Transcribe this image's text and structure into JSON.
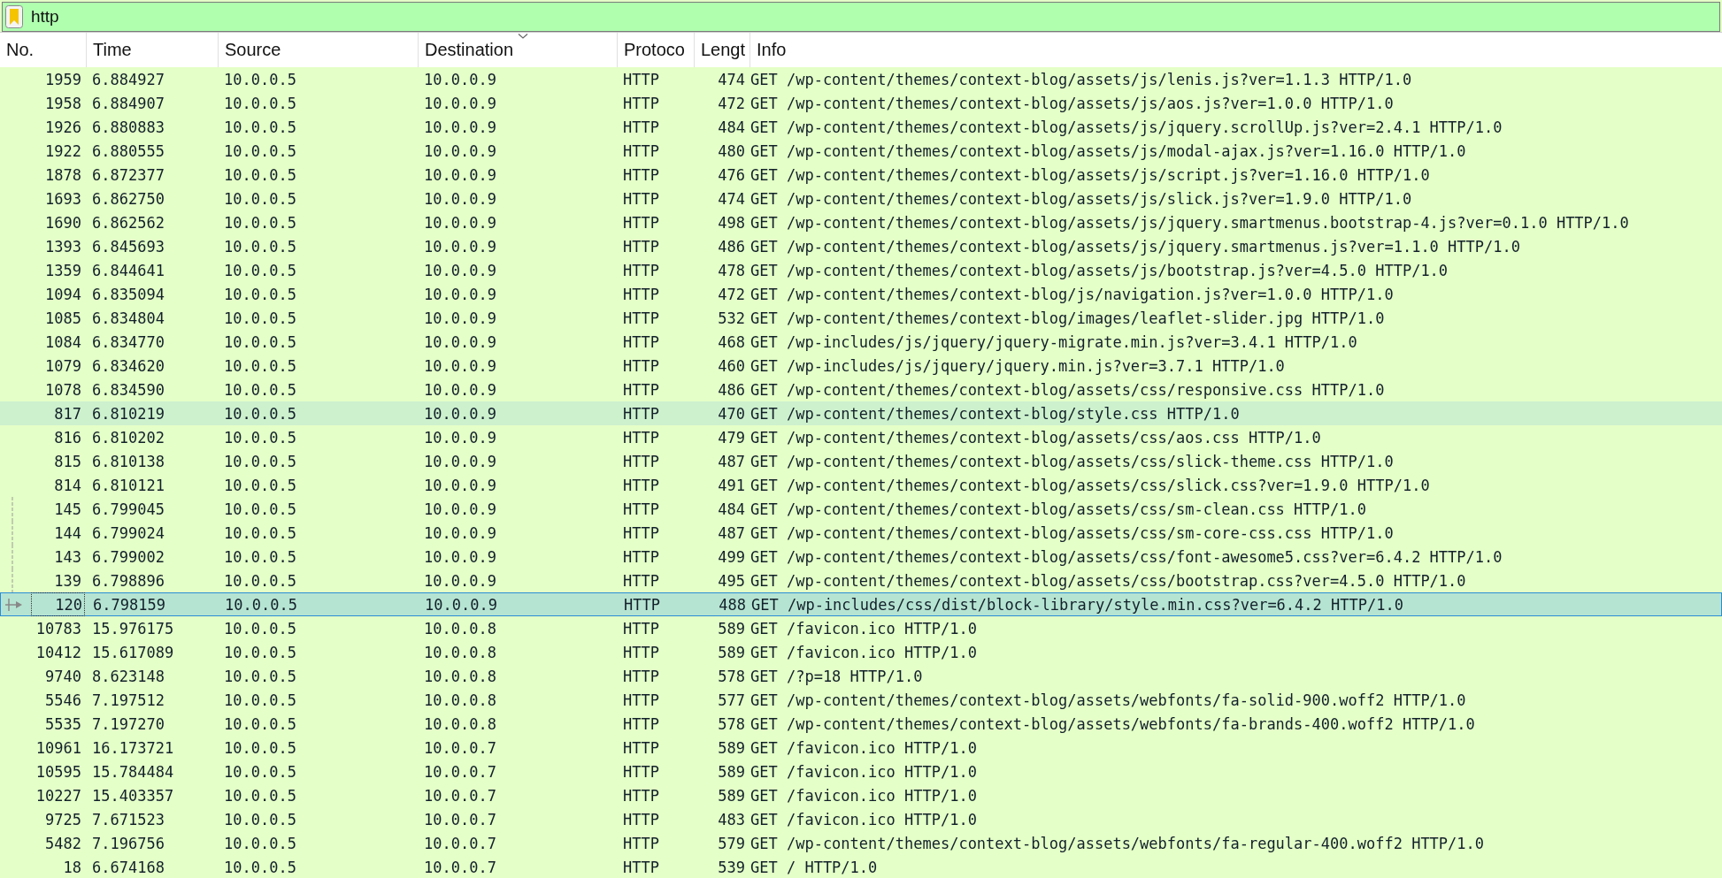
{
  "filter": {
    "value": "http"
  },
  "table": {
    "columns": [
      {
        "label": "No.",
        "sorted": false
      },
      {
        "label": "Time",
        "sorted": false
      },
      {
        "label": "Source",
        "sorted": false
      },
      {
        "label": "Destination",
        "sorted": true
      },
      {
        "label": "Protoco",
        "sorted": false
      },
      {
        "label": "Lengt",
        "sorted": false
      },
      {
        "label": "Info",
        "sorted": false
      }
    ],
    "rows": [
      {
        "no": "1959",
        "time": "6.884927",
        "source": "10.0.0.5",
        "destination": "10.0.0.9",
        "protocol": "HTTP",
        "length": "474",
        "info": "GET /wp-content/themes/context-blog/assets/js/lenis.js?ver=1.1.3 HTTP/1.0",
        "selected": false,
        "hovered": false
      },
      {
        "no": "1958",
        "time": "6.884907",
        "source": "10.0.0.5",
        "destination": "10.0.0.9",
        "protocol": "HTTP",
        "length": "472",
        "info": "GET /wp-content/themes/context-blog/assets/js/aos.js?ver=1.0.0 HTTP/1.0",
        "selected": false,
        "hovered": false
      },
      {
        "no": "1926",
        "time": "6.880883",
        "source": "10.0.0.5",
        "destination": "10.0.0.9",
        "protocol": "HTTP",
        "length": "484",
        "info": "GET /wp-content/themes/context-blog/assets/js/jquery.scrollUp.js?ver=2.4.1 HTTP/1.0",
        "selected": false,
        "hovered": false
      },
      {
        "no": "1922",
        "time": "6.880555",
        "source": "10.0.0.5",
        "destination": "10.0.0.9",
        "protocol": "HTTP",
        "length": "480",
        "info": "GET /wp-content/themes/context-blog/assets/js/modal-ajax.js?ver=1.16.0 HTTP/1.0",
        "selected": false,
        "hovered": false
      },
      {
        "no": "1878",
        "time": "6.872377",
        "source": "10.0.0.5",
        "destination": "10.0.0.9",
        "protocol": "HTTP",
        "length": "476",
        "info": "GET /wp-content/themes/context-blog/assets/js/script.js?ver=1.16.0 HTTP/1.0",
        "selected": false,
        "hovered": false
      },
      {
        "no": "1693",
        "time": "6.862750",
        "source": "10.0.0.5",
        "destination": "10.0.0.9",
        "protocol": "HTTP",
        "length": "474",
        "info": "GET /wp-content/themes/context-blog/assets/js/slick.js?ver=1.9.0 HTTP/1.0",
        "selected": false,
        "hovered": false
      },
      {
        "no": "1690",
        "time": "6.862562",
        "source": "10.0.0.5",
        "destination": "10.0.0.9",
        "protocol": "HTTP",
        "length": "498",
        "info": "GET /wp-content/themes/context-blog/assets/js/jquery.smartmenus.bootstrap-4.js?ver=0.1.0 HTTP/1.0",
        "selected": false,
        "hovered": false
      },
      {
        "no": "1393",
        "time": "6.845693",
        "source": "10.0.0.5",
        "destination": "10.0.0.9",
        "protocol": "HTTP",
        "length": "486",
        "info": "GET /wp-content/themes/context-blog/assets/js/jquery.smartmenus.js?ver=1.1.0 HTTP/1.0",
        "selected": false,
        "hovered": false
      },
      {
        "no": "1359",
        "time": "6.844641",
        "source": "10.0.0.5",
        "destination": "10.0.0.9",
        "protocol": "HTTP",
        "length": "478",
        "info": "GET /wp-content/themes/context-blog/assets/js/bootstrap.js?ver=4.5.0 HTTP/1.0",
        "selected": false,
        "hovered": false
      },
      {
        "no": "1094",
        "time": "6.835094",
        "source": "10.0.0.5",
        "destination": "10.0.0.9",
        "protocol": "HTTP",
        "length": "472",
        "info": "GET /wp-content/themes/context-blog/js/navigation.js?ver=1.0.0 HTTP/1.0",
        "selected": false,
        "hovered": false
      },
      {
        "no": "1085",
        "time": "6.834804",
        "source": "10.0.0.5",
        "destination": "10.0.0.9",
        "protocol": "HTTP",
        "length": "532",
        "info": "GET /wp-content/themes/context-blog/images/leaflet-slider.jpg HTTP/1.0",
        "selected": false,
        "hovered": false
      },
      {
        "no": "1084",
        "time": "6.834770",
        "source": "10.0.0.5",
        "destination": "10.0.0.9",
        "protocol": "HTTP",
        "length": "468",
        "info": "GET /wp-includes/js/jquery/jquery-migrate.min.js?ver=3.4.1 HTTP/1.0",
        "selected": false,
        "hovered": false
      },
      {
        "no": "1079",
        "time": "6.834620",
        "source": "10.0.0.5",
        "destination": "10.0.0.9",
        "protocol": "HTTP",
        "length": "460",
        "info": "GET /wp-includes/js/jquery/jquery.min.js?ver=3.7.1 HTTP/1.0",
        "selected": false,
        "hovered": false
      },
      {
        "no": "1078",
        "time": "6.834590",
        "source": "10.0.0.5",
        "destination": "10.0.0.9",
        "protocol": "HTTP",
        "length": "486",
        "info": "GET /wp-content/themes/context-blog/assets/css/responsive.css HTTP/1.0",
        "selected": false,
        "hovered": false
      },
      {
        "no": "817",
        "time": "6.810219",
        "source": "10.0.0.5",
        "destination": "10.0.0.9",
        "protocol": "HTTP",
        "length": "470",
        "info": "GET /wp-content/themes/context-blog/style.css HTTP/1.0",
        "selected": false,
        "hovered": true
      },
      {
        "no": "816",
        "time": "6.810202",
        "source": "10.0.0.5",
        "destination": "10.0.0.9",
        "protocol": "HTTP",
        "length": "479",
        "info": "GET /wp-content/themes/context-blog/assets/css/aos.css HTTP/1.0",
        "selected": false,
        "hovered": false
      },
      {
        "no": "815",
        "time": "6.810138",
        "source": "10.0.0.5",
        "destination": "10.0.0.9",
        "protocol": "HTTP",
        "length": "487",
        "info": "GET /wp-content/themes/context-blog/assets/css/slick-theme.css HTTP/1.0",
        "selected": false,
        "hovered": false
      },
      {
        "no": "814",
        "time": "6.810121",
        "source": "10.0.0.5",
        "destination": "10.0.0.9",
        "protocol": "HTTP",
        "length": "491",
        "info": "GET /wp-content/themes/context-blog/assets/css/slick.css?ver=1.9.0 HTTP/1.0",
        "selected": false,
        "hovered": false
      },
      {
        "no": "145",
        "time": "6.799045",
        "source": "10.0.0.5",
        "destination": "10.0.0.9",
        "protocol": "HTTP",
        "length": "484",
        "info": "GET /wp-content/themes/context-blog/assets/css/sm-clean.css HTTP/1.0",
        "selected": false,
        "hovered": false,
        "related": true
      },
      {
        "no": "144",
        "time": "6.799024",
        "source": "10.0.0.5",
        "destination": "10.0.0.9",
        "protocol": "HTTP",
        "length": "487",
        "info": "GET /wp-content/themes/context-blog/assets/css/sm-core-css.css HTTP/1.0",
        "selected": false,
        "hovered": false,
        "related": true
      },
      {
        "no": "143",
        "time": "6.799002",
        "source": "10.0.0.5",
        "destination": "10.0.0.9",
        "protocol": "HTTP",
        "length": "499",
        "info": "GET /wp-content/themes/context-blog/assets/css/font-awesome5.css?ver=6.4.2 HTTP/1.0",
        "selected": false,
        "hovered": false,
        "related": true
      },
      {
        "no": "139",
        "time": "6.798896",
        "source": "10.0.0.5",
        "destination": "10.0.0.9",
        "protocol": "HTTP",
        "length": "495",
        "info": "GET /wp-content/themes/context-blog/assets/css/bootstrap.css?ver=4.5.0 HTTP/1.0",
        "selected": false,
        "hovered": false,
        "related": true
      },
      {
        "no": "120",
        "time": "6.798159",
        "source": "10.0.0.5",
        "destination": "10.0.0.9",
        "protocol": "HTTP",
        "length": "488",
        "info": "GET /wp-includes/css/dist/block-library/style.min.css?ver=6.4.2 HTTP/1.0",
        "selected": true,
        "hovered": false,
        "related": true
      },
      {
        "no": "10783",
        "time": "15.976175",
        "source": "10.0.0.5",
        "destination": "10.0.0.8",
        "protocol": "HTTP",
        "length": "589",
        "info": "GET /favicon.ico HTTP/1.0",
        "selected": false,
        "hovered": false
      },
      {
        "no": "10412",
        "time": "15.617089",
        "source": "10.0.0.5",
        "destination": "10.0.0.8",
        "protocol": "HTTP",
        "length": "589",
        "info": "GET /favicon.ico HTTP/1.0",
        "selected": false,
        "hovered": false
      },
      {
        "no": "9740",
        "time": "8.623148",
        "source": "10.0.0.5",
        "destination": "10.0.0.8",
        "protocol": "HTTP",
        "length": "578",
        "info": "GET /?p=18 HTTP/1.0",
        "selected": false,
        "hovered": false
      },
      {
        "no": "5546",
        "time": "7.197512",
        "source": "10.0.0.5",
        "destination": "10.0.0.8",
        "protocol": "HTTP",
        "length": "577",
        "info": "GET /wp-content/themes/context-blog/assets/webfonts/fa-solid-900.woff2 HTTP/1.0",
        "selected": false,
        "hovered": false
      },
      {
        "no": "5535",
        "time": "7.197270",
        "source": "10.0.0.5",
        "destination": "10.0.0.8",
        "protocol": "HTTP",
        "length": "578",
        "info": "GET /wp-content/themes/context-blog/assets/webfonts/fa-brands-400.woff2 HTTP/1.0",
        "selected": false,
        "hovered": false
      },
      {
        "no": "10961",
        "time": "16.173721",
        "source": "10.0.0.5",
        "destination": "10.0.0.7",
        "protocol": "HTTP",
        "length": "589",
        "info": "GET /favicon.ico HTTP/1.0",
        "selected": false,
        "hovered": false
      },
      {
        "no": "10595",
        "time": "15.784484",
        "source": "10.0.0.5",
        "destination": "10.0.0.7",
        "protocol": "HTTP",
        "length": "589",
        "info": "GET /favicon.ico HTTP/1.0",
        "selected": false,
        "hovered": false
      },
      {
        "no": "10227",
        "time": "15.403357",
        "source": "10.0.0.5",
        "destination": "10.0.0.7",
        "protocol": "HTTP",
        "length": "589",
        "info": "GET /favicon.ico HTTP/1.0",
        "selected": false,
        "hovered": false
      },
      {
        "no": "9725",
        "time": "7.671523",
        "source": "10.0.0.5",
        "destination": "10.0.0.7",
        "protocol": "HTTP",
        "length": "483",
        "info": "GET /favicon.ico HTTP/1.0",
        "selected": false,
        "hovered": false
      },
      {
        "no": "5482",
        "time": "7.196756",
        "source": "10.0.0.5",
        "destination": "10.0.0.7",
        "protocol": "HTTP",
        "length": "579",
        "info": "GET /wp-content/themes/context-blog/assets/webfonts/fa-regular-400.woff2 HTTP/1.0",
        "selected": false,
        "hovered": false
      },
      {
        "no": "18",
        "time": "6.674168",
        "source": "10.0.0.5",
        "destination": "10.0.0.7",
        "protocol": "HTTP",
        "length": "539",
        "info": "GET / HTTP/1.0",
        "selected": false,
        "hovered": false
      }
    ]
  }
}
